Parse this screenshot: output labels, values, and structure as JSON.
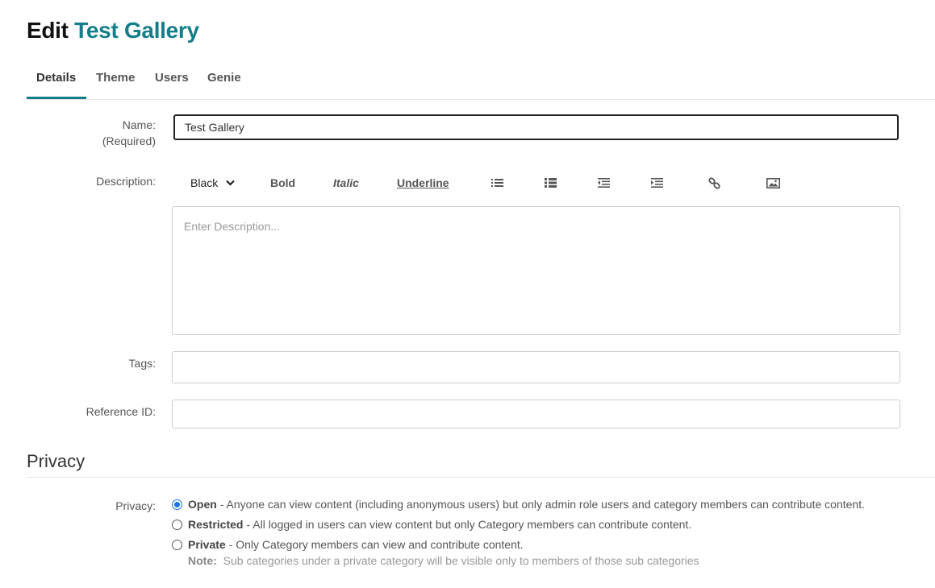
{
  "header": {
    "prefix": "Edit",
    "gallery_name": "Test Gallery"
  },
  "tabs": [
    {
      "label": "Details",
      "active": true
    },
    {
      "label": "Theme",
      "active": false
    },
    {
      "label": "Users",
      "active": false
    },
    {
      "label": "Genie",
      "active": false
    }
  ],
  "form": {
    "name_label": "Name:",
    "name_required": "(Required)",
    "name_value": "Test Gallery",
    "description_label": "Description:",
    "description_placeholder": "Enter Description...",
    "tags_label": "Tags:",
    "tags_value": "",
    "reference_label": "Reference ID:",
    "reference_value": ""
  },
  "toolbar": {
    "color_value": "Black",
    "bold_label": "Bold",
    "italic_label": "Italic",
    "underline_label": "Underline",
    "icons": [
      "bulleted-list-icon",
      "numbered-list-icon",
      "outdent-icon",
      "indent-icon",
      "link-icon",
      "image-icon"
    ]
  },
  "privacy": {
    "section_title": "Privacy",
    "label": "Privacy:",
    "selected": "Open",
    "options": [
      {
        "name": "Open",
        "description": "- Anyone can view content (including anonymous users) but only admin role users and category members can contribute content."
      },
      {
        "name": "Restricted",
        "description": "- All logged in users can view content but only Category members can contribute content."
      },
      {
        "name": "Private",
        "description": "- Only Category members can view and contribute content."
      }
    ],
    "note_label": "Note:",
    "note_text": "Sub categories under a private category will be visible only to members of those sub categories"
  },
  "colors": {
    "accent": "#137d8a",
    "radio_selected": "#1a73e8"
  }
}
